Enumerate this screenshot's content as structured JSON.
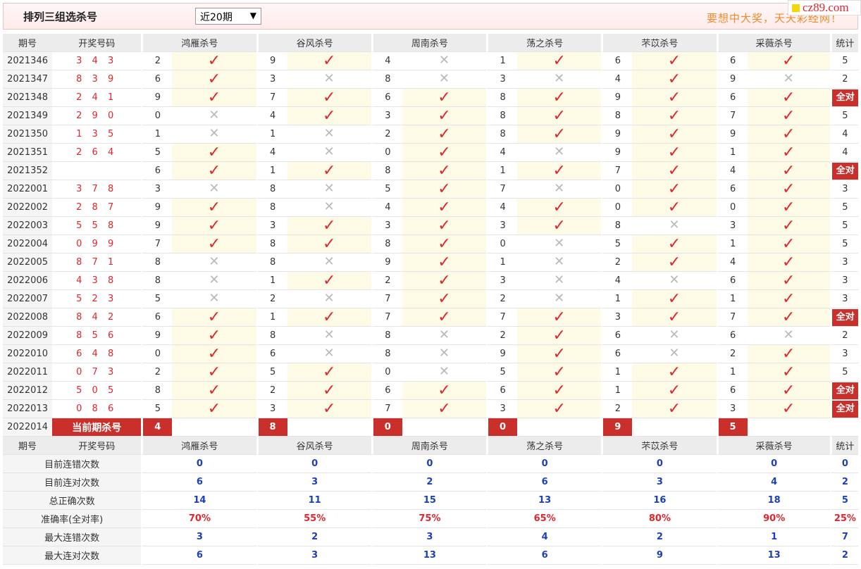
{
  "title": "排列三组选杀号",
  "period_select": "近20期",
  "slogan": "要想中大奖，天天彩经网！",
  "logo_text": "cz89.com",
  "headers": {
    "period": "期号",
    "numbers": "开奖号码",
    "experts": [
      "鸿雁杀号",
      "谷风杀号",
      "周南杀号",
      "荡之杀号",
      "芣苡杀号",
      "采薇杀号"
    ],
    "stats": "统计"
  },
  "rows": [
    {
      "period": "2021346",
      "nums": "3 4 3",
      "kills": [
        [
          "2",
          1
        ],
        [
          "9",
          1
        ],
        [
          "4",
          0
        ],
        [
          "1",
          1
        ],
        [
          "6",
          1
        ],
        [
          "6",
          1
        ]
      ],
      "count": "5"
    },
    {
      "period": "2021347",
      "nums": "8 3 9",
      "kills": [
        [
          "6",
          1
        ],
        [
          "3",
          0
        ],
        [
          "8",
          0
        ],
        [
          "3",
          0
        ],
        [
          "4",
          1
        ],
        [
          "9",
          0
        ]
      ],
      "count": "2"
    },
    {
      "period": "2021348",
      "nums": "2 4 1",
      "kills": [
        [
          "9",
          1
        ],
        [
          "7",
          1
        ],
        [
          "6",
          1
        ],
        [
          "8",
          1
        ],
        [
          "9",
          1
        ],
        [
          "6",
          1
        ]
      ],
      "count": "全对"
    },
    {
      "period": "2021349",
      "nums": "2 9 0",
      "kills": [
        [
          "0",
          0
        ],
        [
          "4",
          1
        ],
        [
          "3",
          1
        ],
        [
          "8",
          1
        ],
        [
          "8",
          1
        ],
        [
          "7",
          1
        ]
      ],
      "count": "5"
    },
    {
      "period": "2021350",
      "nums": "1 3 5",
      "kills": [
        [
          "1",
          0
        ],
        [
          "1",
          0
        ],
        [
          "2",
          1
        ],
        [
          "8",
          1
        ],
        [
          "9",
          1
        ],
        [
          "9",
          1
        ]
      ],
      "count": "4"
    },
    {
      "period": "2021351",
      "nums": "2 6 4",
      "kills": [
        [
          "5",
          1
        ],
        [
          "4",
          0
        ],
        [
          "0",
          1
        ],
        [
          "4",
          0
        ],
        [
          "9",
          1
        ],
        [
          "1",
          1
        ]
      ],
      "count": "4"
    },
    {
      "period": "2021352",
      "nums": "",
      "kills": [
        [
          "6",
          1
        ],
        [
          "1",
          1
        ],
        [
          "8",
          1
        ],
        [
          "1",
          1
        ],
        [
          "7",
          1
        ],
        [
          "4",
          1
        ]
      ],
      "count": "全对"
    },
    {
      "period": "2022001",
      "nums": "3 7 8",
      "kills": [
        [
          "3",
          0
        ],
        [
          "8",
          0
        ],
        [
          "5",
          1
        ],
        [
          "7",
          0
        ],
        [
          "0",
          1
        ],
        [
          "6",
          1
        ]
      ],
      "count": "3"
    },
    {
      "period": "2022002",
      "nums": "2 8 7",
      "kills": [
        [
          "9",
          1
        ],
        [
          "8",
          0
        ],
        [
          "4",
          1
        ],
        [
          "4",
          1
        ],
        [
          "0",
          1
        ],
        [
          "0",
          1
        ]
      ],
      "count": "5"
    },
    {
      "period": "2022003",
      "nums": "5 5 8",
      "kills": [
        [
          "9",
          1
        ],
        [
          "3",
          1
        ],
        [
          "3",
          1
        ],
        [
          "3",
          1
        ],
        [
          "8",
          0
        ],
        [
          "3",
          1
        ]
      ],
      "count": "5"
    },
    {
      "period": "2022004",
      "nums": "0 9 9",
      "kills": [
        [
          "7",
          1
        ],
        [
          "8",
          1
        ],
        [
          "8",
          1
        ],
        [
          "0",
          0
        ],
        [
          "5",
          1
        ],
        [
          "1",
          1
        ]
      ],
      "count": "5"
    },
    {
      "period": "2022005",
      "nums": "8 7 1",
      "kills": [
        [
          "8",
          0
        ],
        [
          "8",
          0
        ],
        [
          "9",
          1
        ],
        [
          "1",
          0
        ],
        [
          "2",
          1
        ],
        [
          "4",
          1
        ]
      ],
      "count": "3"
    },
    {
      "period": "2022006",
      "nums": "4 3 8",
      "kills": [
        [
          "8",
          0
        ],
        [
          "1",
          1
        ],
        [
          "2",
          1
        ],
        [
          "3",
          0
        ],
        [
          "4",
          0
        ],
        [
          "6",
          1
        ]
      ],
      "count": "3"
    },
    {
      "period": "2022007",
      "nums": "5 2 3",
      "kills": [
        [
          "5",
          0
        ],
        [
          "2",
          0
        ],
        [
          "7",
          1
        ],
        [
          "2",
          0
        ],
        [
          "1",
          1
        ],
        [
          "1",
          1
        ]
      ],
      "count": "3"
    },
    {
      "period": "2022008",
      "nums": "8 4 2",
      "kills": [
        [
          "6",
          1
        ],
        [
          "1",
          1
        ],
        [
          "7",
          1
        ],
        [
          "7",
          1
        ],
        [
          "3",
          1
        ],
        [
          "7",
          1
        ]
      ],
      "count": "全对"
    },
    {
      "period": "2022009",
      "nums": "8 5 6",
      "kills": [
        [
          "9",
          1
        ],
        [
          "8",
          0
        ],
        [
          "8",
          0
        ],
        [
          "2",
          1
        ],
        [
          "6",
          0
        ],
        [
          "6",
          0
        ]
      ],
      "count": "2"
    },
    {
      "period": "2022010",
      "nums": "6 4 8",
      "kills": [
        [
          "0",
          1
        ],
        [
          "6",
          0
        ],
        [
          "8",
          0
        ],
        [
          "9",
          1
        ],
        [
          "6",
          0
        ],
        [
          "2",
          1
        ]
      ],
      "count": "3"
    },
    {
      "period": "2022011",
      "nums": "0 7 3",
      "kills": [
        [
          "2",
          1
        ],
        [
          "5",
          1
        ],
        [
          "0",
          0
        ],
        [
          "5",
          1
        ],
        [
          "1",
          1
        ],
        [
          "1",
          1
        ]
      ],
      "count": "5"
    },
    {
      "period": "2022012",
      "nums": "5 0 5",
      "kills": [
        [
          "8",
          1
        ],
        [
          "2",
          1
        ],
        [
          "6",
          1
        ],
        [
          "6",
          1
        ],
        [
          "1",
          1
        ],
        [
          "6",
          1
        ]
      ],
      "count": "全对"
    },
    {
      "period": "2022013",
      "nums": "0 8 6",
      "kills": [
        [
          "5",
          1
        ],
        [
          "3",
          1
        ],
        [
          "7",
          1
        ],
        [
          "3",
          1
        ],
        [
          "2",
          1
        ],
        [
          "3",
          1
        ]
      ],
      "count": "全对"
    }
  ],
  "current": {
    "period": "2022014",
    "label": "当前期杀号",
    "kills": [
      "4",
      "8",
      "0",
      "0",
      "9",
      "5"
    ]
  },
  "summary": [
    {
      "label": "目前连错次数",
      "values": [
        "0",
        "0",
        "0",
        "0",
        "0",
        "0"
      ],
      "stat": "0",
      "pct": false
    },
    {
      "label": "目前连对次数",
      "values": [
        "6",
        "3",
        "2",
        "6",
        "3",
        "4"
      ],
      "stat": "2",
      "pct": false
    },
    {
      "label": "总正确次数",
      "values": [
        "14",
        "11",
        "15",
        "13",
        "16",
        "18"
      ],
      "stat": "5",
      "pct": false
    },
    {
      "label": "准确率(全对率)",
      "values": [
        "70%",
        "55%",
        "75%",
        "65%",
        "80%",
        "90%"
      ],
      "stat": "25%",
      "pct": true
    },
    {
      "label": "最大连错次数",
      "values": [
        "3",
        "2",
        "3",
        "4",
        "2",
        "1"
      ],
      "stat": "7",
      "pct": false
    },
    {
      "label": "最大连对次数",
      "values": [
        "6",
        "3",
        "13",
        "6",
        "9",
        "13"
      ],
      "stat": "2",
      "pct": false
    }
  ],
  "marks": {
    "ok": "✓",
    "no": "✕"
  },
  "colors": {
    "accent_red": "#c9302c",
    "mark_red": "#e0262e",
    "summary_blue": "#1d3fb8",
    "slogan_orange": "#f08a2c",
    "yes_cell_bg": "#fdfbe6"
  }
}
